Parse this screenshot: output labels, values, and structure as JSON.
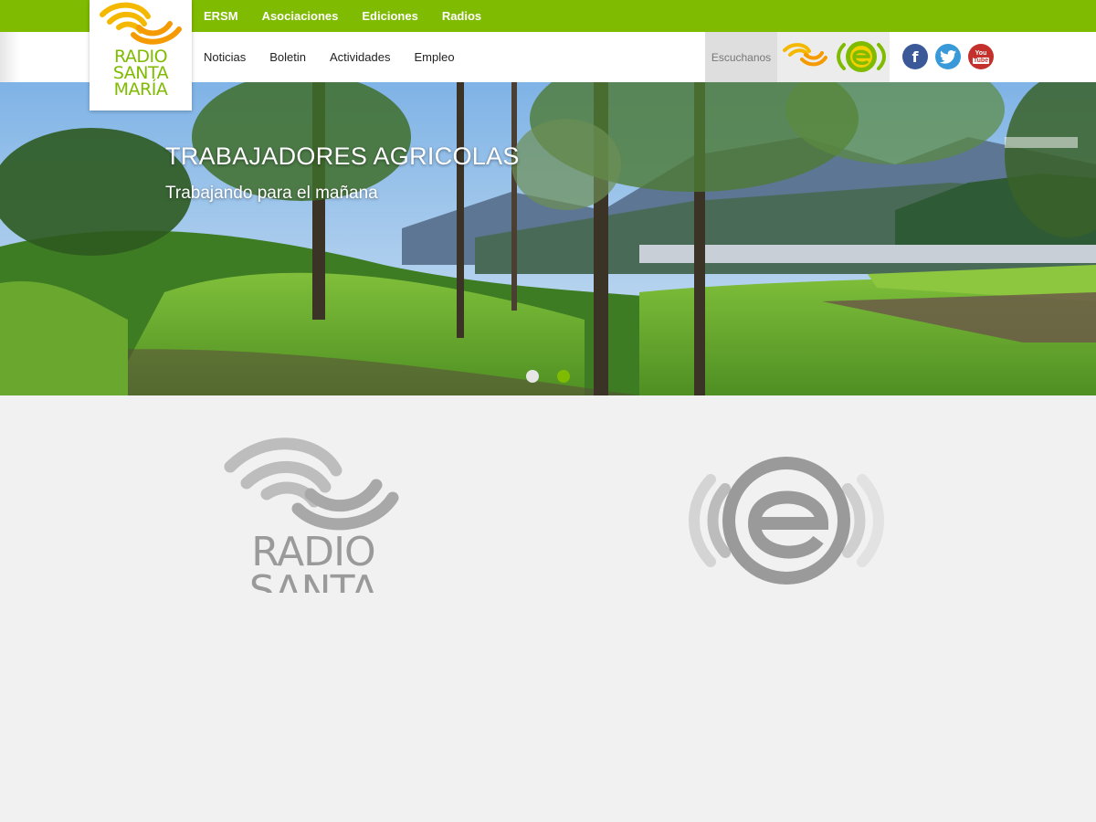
{
  "top_nav": {
    "items": [
      "ERSM",
      "Asociaciones",
      "Ediciones",
      "Radios"
    ]
  },
  "sub_nav": {
    "items": [
      "Noticias",
      "Boletin",
      "Actividades",
      "Empleo"
    ]
  },
  "logo": {
    "line1": "RADIO",
    "line2": "SANTA",
    "line3": "MARÍA"
  },
  "listen": {
    "label": "Escuchanos",
    "stations": [
      "radio-santa-maria-icon",
      "e-station-icon"
    ]
  },
  "social": {
    "facebook": "f",
    "youtube_top": "You",
    "youtube_bottom": "Tube"
  },
  "hero": {
    "title": "TRABAJADORES AGRICOLAS",
    "subtitle": "Trabajando para el mañana",
    "slides": 2,
    "active_slide": 2
  },
  "featured": {
    "rsm_line1": "RADIO",
    "rsm_line2": "SANTA"
  },
  "colors": {
    "brand_green": "#7fbb00",
    "brand_yellow": "#f5b800",
    "facebook": "#3b5998",
    "twitter": "#3a9ad9",
    "youtube": "#c4302b"
  }
}
